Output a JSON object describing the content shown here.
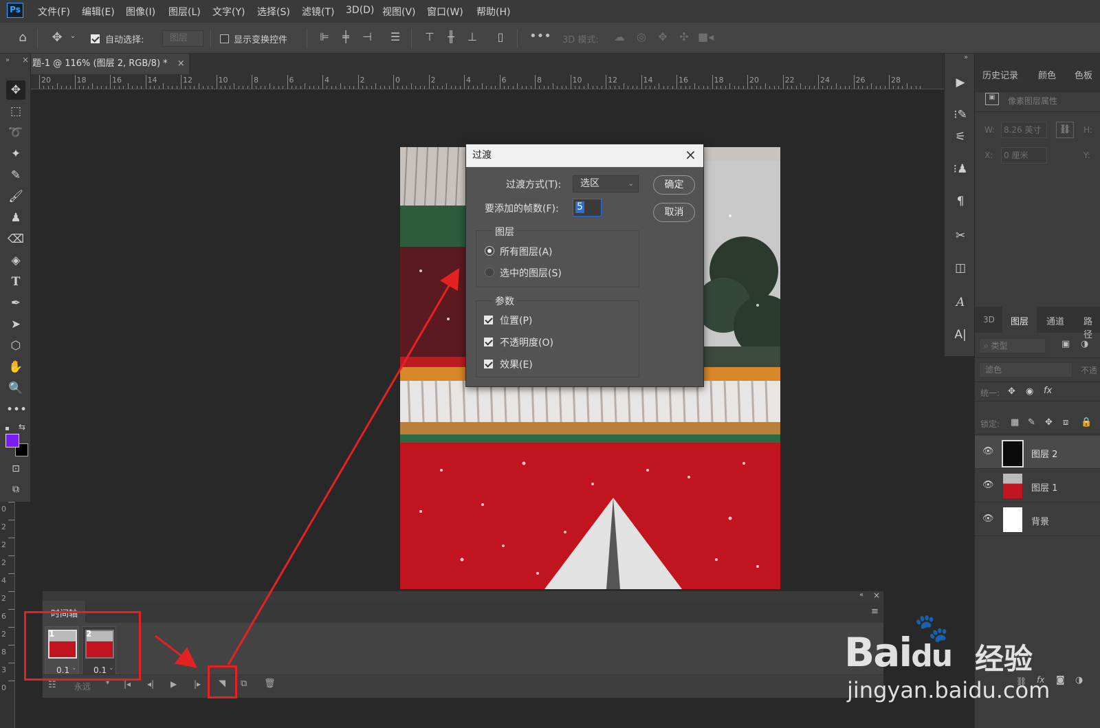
{
  "app": {
    "logo": "Ps"
  },
  "menu": [
    "文件(F)",
    "编辑(E)",
    "图像(I)",
    "图层(L)",
    "文字(Y)",
    "选择(S)",
    "滤镜(T)",
    "3D(D)",
    "视图(V)",
    "窗口(W)",
    "帮助(H)"
  ],
  "options": {
    "auto_select_label": "自动选择:",
    "auto_select_value": "图层",
    "show_transform_label": "显示变换控件",
    "mode_3d_label": "3D 模式:"
  },
  "document": {
    "tab_title": "题-1 @ 116% (图层 2, RGB/8) *",
    "close": "×"
  },
  "ruler_h": [
    "20",
    "18",
    "16",
    "14",
    "12",
    "10",
    "8",
    "6",
    "4",
    "2",
    "0",
    "2",
    "4",
    "6",
    "8",
    "10",
    "12",
    "14",
    "16",
    "18",
    "20",
    "22",
    "24",
    "26",
    "28"
  ],
  "ruler_v": [
    "0",
    "2",
    "2",
    "2",
    "4",
    "2",
    "6",
    "2",
    "8",
    "3",
    "0"
  ],
  "dialog": {
    "title": "过渡",
    "transition_label": "过渡方式(T):",
    "transition_value": "选区",
    "frames_label": "要添加的帧数(F):",
    "frames_value": "5",
    "ok": "确定",
    "cancel": "取消",
    "layers_group": "图层",
    "all_layers": "所有图层(A)",
    "selected_layers": "选中的图层(S)",
    "params_group": "参数",
    "position": "位置(P)",
    "opacity": "不透明度(O)",
    "effects": "效果(E)"
  },
  "right_tabs_top": [
    "历史记录",
    "颜色",
    "色板"
  ],
  "properties": {
    "title": "像素图层属性",
    "w_label": "W:",
    "w_value": "8.26 英寸",
    "h_label": "H:",
    "x_label": "X:",
    "x_value": "0 厘米",
    "y_label": "Y:"
  },
  "right_tabs_layers": [
    "3D",
    "图层",
    "通道",
    "路径"
  ],
  "layers_panel": {
    "search_placeholder": "类型",
    "blend_mode": "滤色",
    "opacity_label": "不透",
    "unify_label": "统一:",
    "lock_label": "锁定:"
  },
  "layers": [
    {
      "name": "图层 2"
    },
    {
      "name": "图层 1"
    },
    {
      "name": "背景"
    }
  ],
  "timeline": {
    "title": "时间轴",
    "frames": [
      {
        "num": "1",
        "delay": "0.1"
      },
      {
        "num": "2",
        "delay": "0.1"
      }
    ],
    "loop": "永远"
  },
  "watermark": {
    "brand": "Bai",
    "du": "du",
    "suffix": "经验",
    "url": "jingyan.baidu.com"
  },
  "colors": {
    "foreground": "#7b1cff",
    "background": "#000000",
    "annotation": "#e52222"
  }
}
